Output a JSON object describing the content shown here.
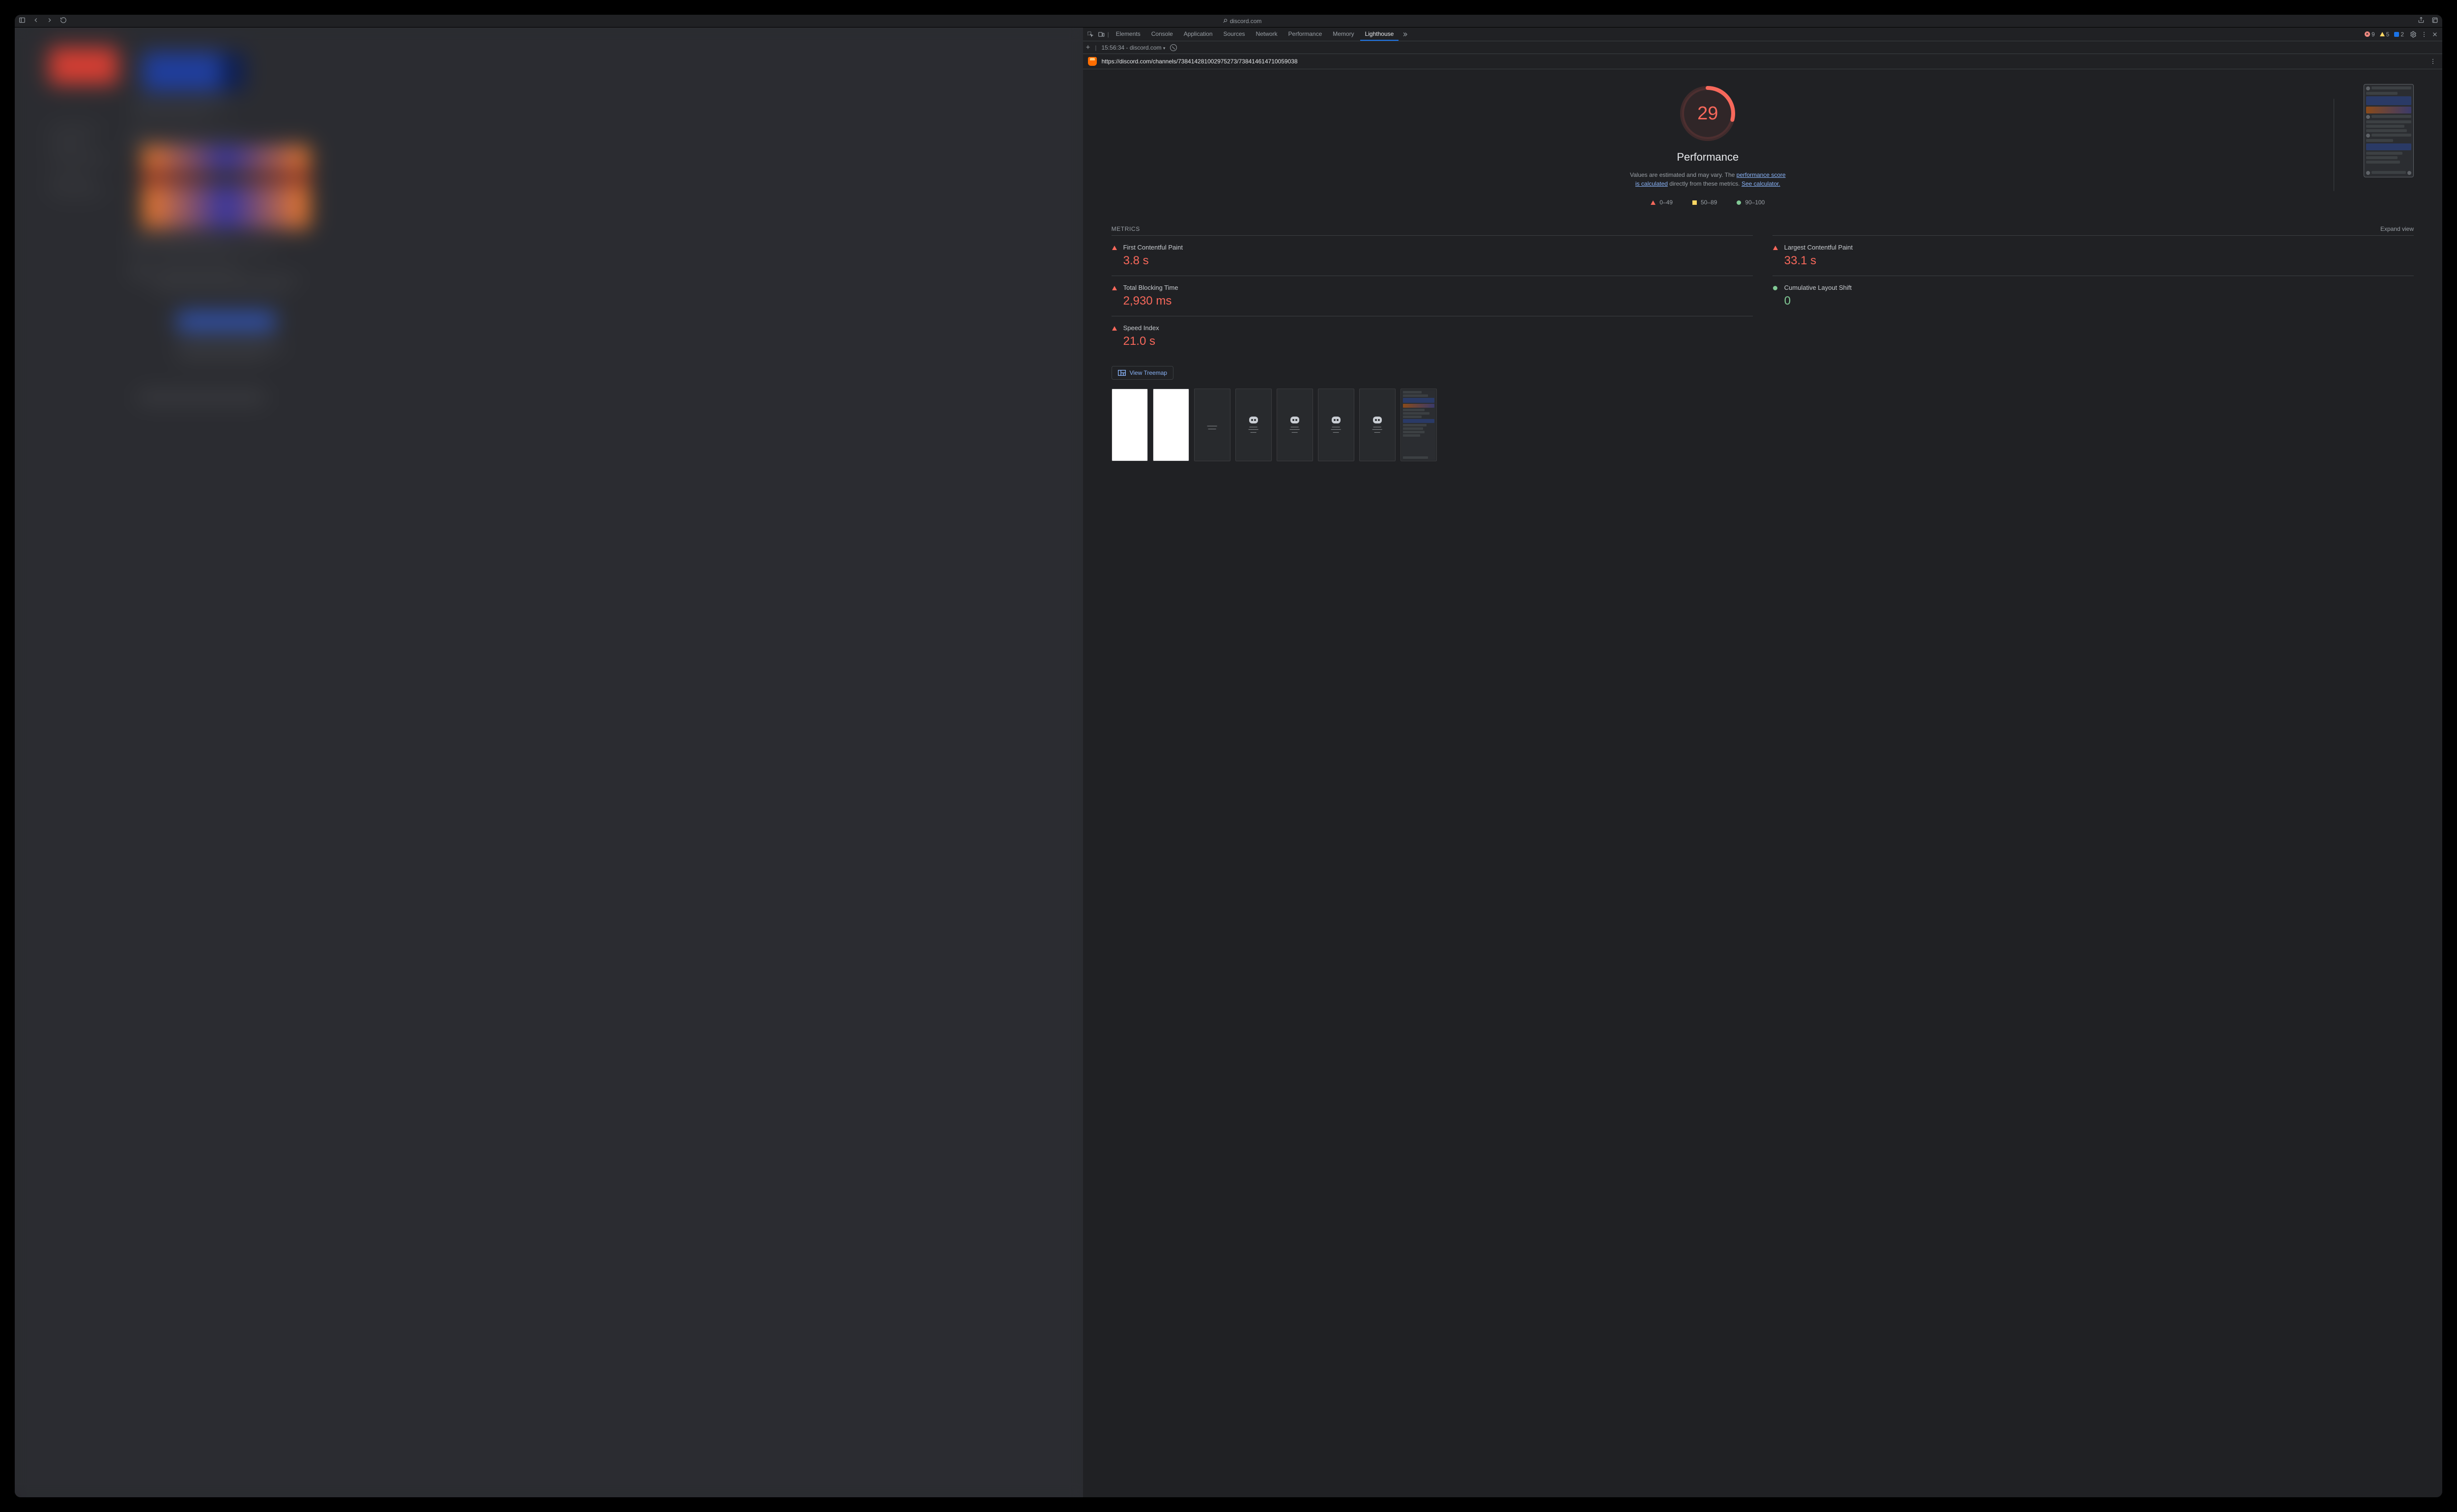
{
  "browser": {
    "page_domain": "discord.com"
  },
  "devtools": {
    "tabs": [
      "Elements",
      "Console",
      "Application",
      "Sources",
      "Network",
      "Performance",
      "Memory",
      "Lighthouse"
    ],
    "active_tab": "Lighthouse",
    "counts": {
      "errors": "9",
      "warnings": "5",
      "issues": "2"
    },
    "subbar": {
      "time": "15:56:34",
      "domain": "discord.com"
    },
    "audit_url": "https://discord.com/channels/738414281002975273/738414614710059038"
  },
  "chart_data": {
    "type": "gauge",
    "value": 29,
    "range": [
      0,
      100
    ],
    "title": "Performance",
    "bands": [
      {
        "label": "0–49",
        "meaning": "fail",
        "color": "#f7685b"
      },
      {
        "label": "50–89",
        "meaning": "average",
        "color": "#fdd663"
      },
      {
        "label": "90–100",
        "meaning": "pass",
        "color": "#81c995"
      }
    ]
  },
  "performance": {
    "score": "29",
    "title": "Performance",
    "desc_prefix": "Values are estimated and may vary. The ",
    "desc_link1": "performance score is calculated",
    "desc_mid": " directly from these metrics. ",
    "desc_link2": "See calculator.",
    "legend": {
      "fail": "0–49",
      "avg": "50–89",
      "pass": "90–100"
    }
  },
  "metrics_header": {
    "title": "METRICS",
    "expand": "Expand view"
  },
  "metrics": {
    "fcp": {
      "label": "First Contentful Paint",
      "value": "3.8 s",
      "status": "fail"
    },
    "lcp": {
      "label": "Largest Contentful Paint",
      "value": "33.1 s",
      "status": "fail"
    },
    "tbt": {
      "label": "Total Blocking Time",
      "value": "2,930 ms",
      "status": "fail"
    },
    "cls": {
      "label": "Cumulative Layout Shift",
      "value": "0",
      "status": "pass"
    },
    "si": {
      "label": "Speed Index",
      "value": "21.0 s",
      "status": "fail"
    }
  },
  "treemap_button": "View Treemap"
}
